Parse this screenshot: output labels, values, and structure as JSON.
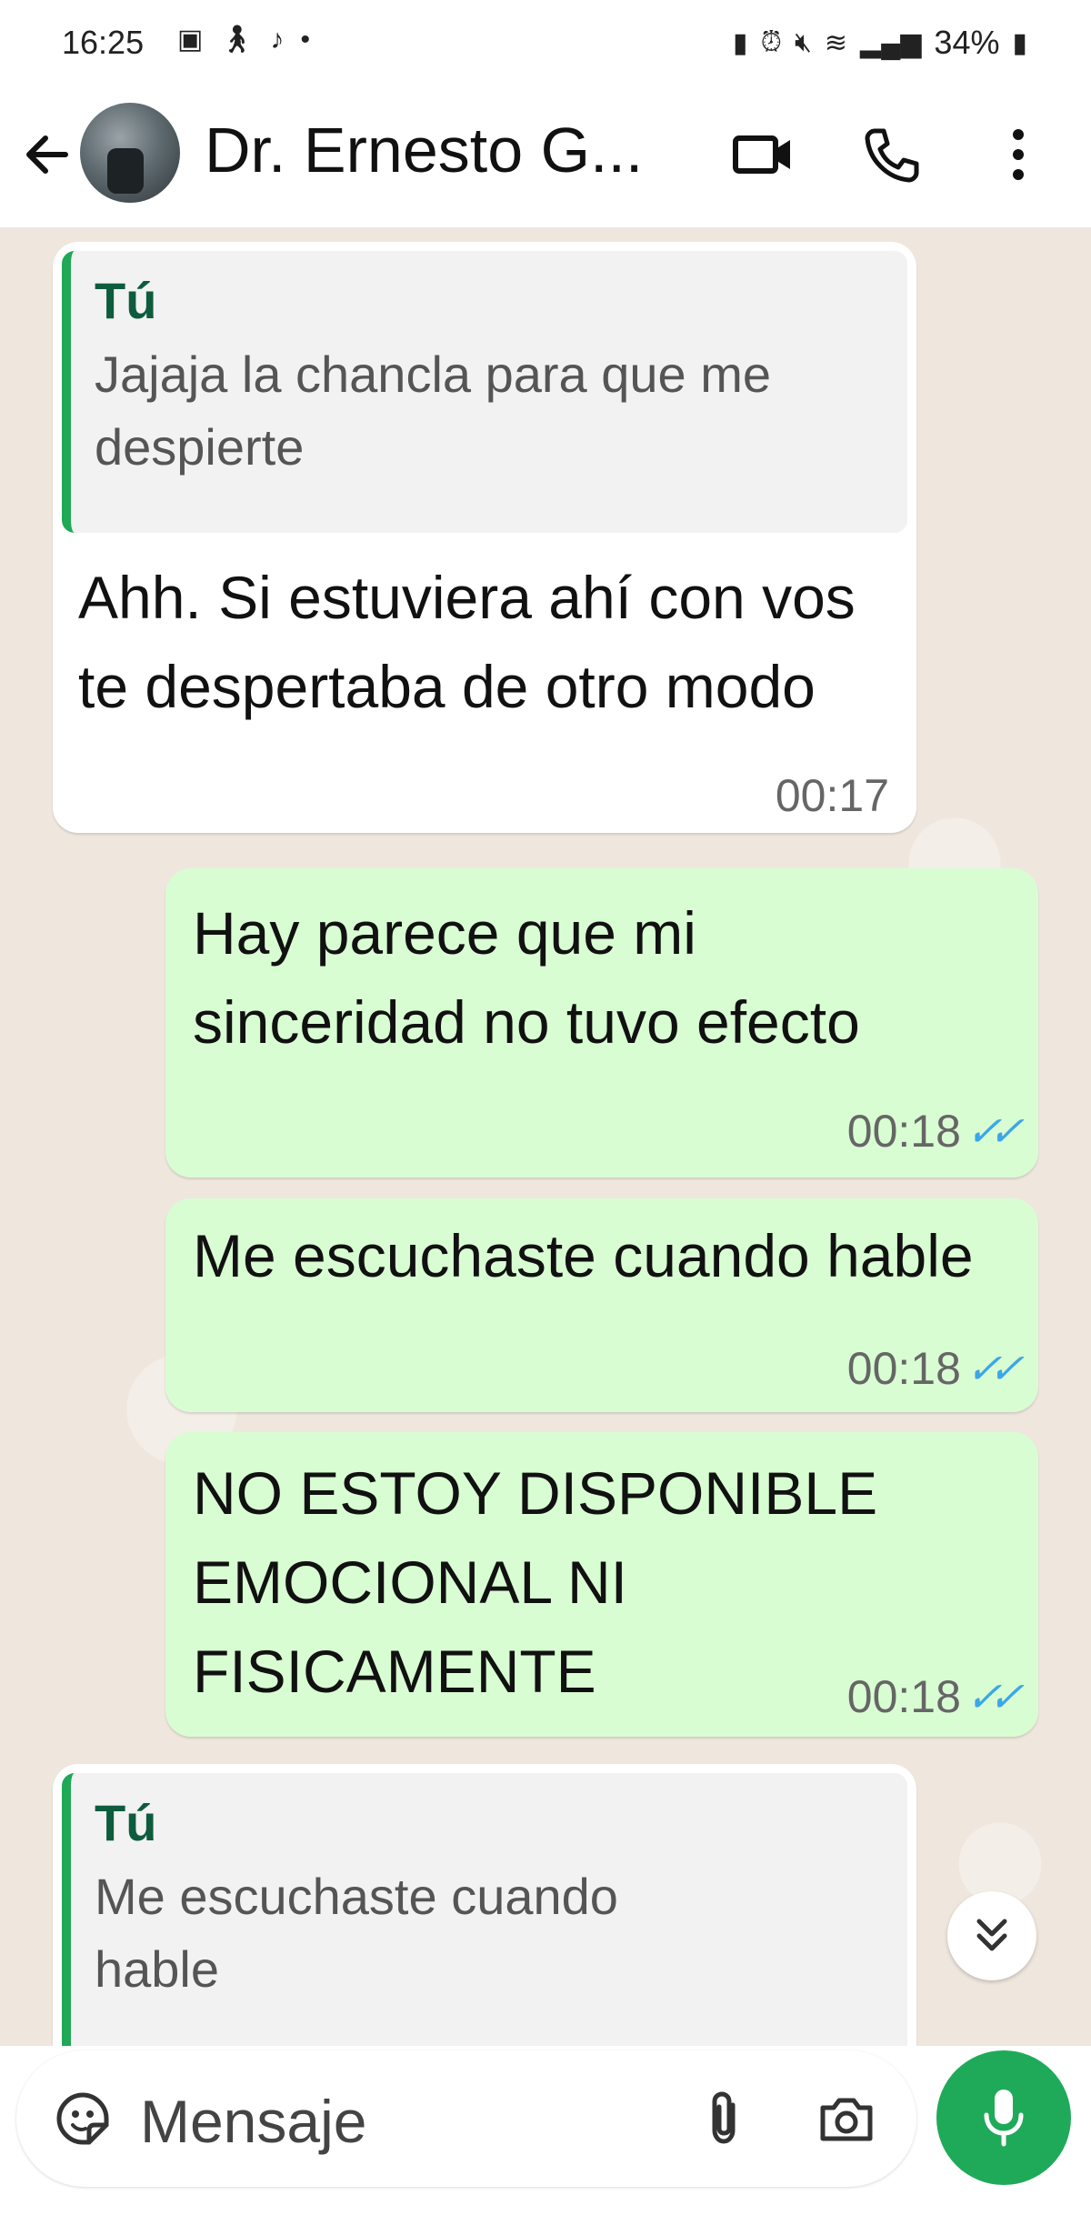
{
  "status": {
    "time": "16:25",
    "battery": "34%"
  },
  "header": {
    "contact_name": "Dr. Ernesto G...",
    "icons": [
      "back-arrow-icon",
      "video-call-icon",
      "phone-icon",
      "more-vert-icon"
    ]
  },
  "messages": [
    {
      "direction": "incoming",
      "quote_author": "Tú",
      "quote_text": "Jajaja la chancla para que me despierte",
      "text": "Ahh. Si estuviera ahí con vos te despertaba de otro modo",
      "time": "00:17"
    },
    {
      "direction": "outgoing",
      "text": "Hay parece que mi sinceridad no tuvo efecto",
      "time": "00:18",
      "status": "read"
    },
    {
      "direction": "outgoing",
      "text": "Me escuchaste cuando hable",
      "time": "00:18",
      "status": "read"
    },
    {
      "direction": "outgoing",
      "text": "NO ESTOY DISPONIBLE EMOCIONAL NI FISICAMENTE",
      "time": "00:18",
      "status": "read"
    },
    {
      "direction": "incoming",
      "quote_author": "Tú",
      "quote_text": "Me escuchaste cuando hable"
    }
  ],
  "composer": {
    "placeholder": "Mensaje"
  },
  "colors": {
    "accent_green": "#1faa59",
    "outgoing_bubble": "#d9fdd3",
    "read_ticks": "#3ba7e8"
  }
}
